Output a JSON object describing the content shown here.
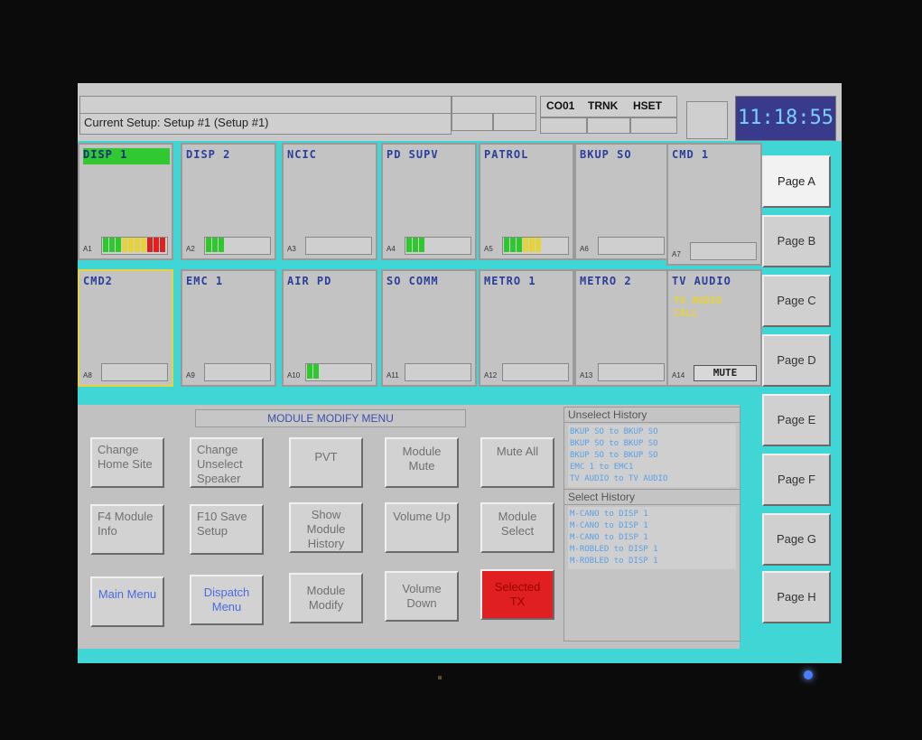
{
  "header": {
    "setup_text": "Current Setup: Setup #1 (Setup #1)",
    "co_label": "CO01",
    "trnk_label": "TRNK",
    "hset_label": "HSET",
    "clock": "11:18:55"
  },
  "modules_row1": [
    {
      "title": "DISP 1",
      "id": "A1"
    },
    {
      "title": "DISP 2",
      "id": "A2"
    },
    {
      "title": "NCIC",
      "id": "A3"
    },
    {
      "title": "PD SUPV",
      "id": "A4"
    },
    {
      "title": "PATROL",
      "id": "A5"
    },
    {
      "title": "BKUP SO",
      "id": "A6"
    },
    {
      "title": "CMD 1",
      "id": "A7"
    }
  ],
  "modules_row2": [
    {
      "title": "CMD2",
      "id": "A8"
    },
    {
      "title": "EMC 1",
      "id": "A9"
    },
    {
      "title": "AIR PD",
      "id": "A10"
    },
    {
      "title": "SO COMM",
      "id": "A11"
    },
    {
      "title": "METRO 1",
      "id": "A12"
    },
    {
      "title": "METRO 2",
      "id": "A13"
    },
    {
      "title": "TV AUDIO",
      "id": "A14",
      "sub1": "TV AUDIO",
      "sub2": "CALL",
      "mute": "MUTE"
    }
  ],
  "menu": {
    "title": "MODULE MODIFY MENU",
    "buttons": [
      "Change Home Site",
      "Change Unselect Speaker",
      "PVT",
      "Module Mute",
      "Mute All",
      "F4 Module Info",
      "F10 Save Setup",
      "Show Module History",
      "Volume Up",
      "Module Select",
      "Main Menu",
      "Dispatch Menu",
      "Module Modify",
      "Volume Down",
      "Selected TX"
    ]
  },
  "unselect_history": {
    "title": "Unselect History",
    "rows": [
      "BKUP SO   to BKUP SO",
      "BKUP SO   to BKUP SO",
      "BKUP SO   to BKUP SO",
      "EMC 1     to EMC1",
      "TV AUDIO to TV AUDIO"
    ]
  },
  "select_history": {
    "title": "Select History",
    "rows": [
      "M-CANO    to DISP 1",
      "M-CANO    to DISP 1",
      "M-CANO    to DISP 1",
      "M-ROBLED  to DISP 1",
      "M-ROBLED  to DISP 1"
    ]
  },
  "pages": [
    "Page A",
    "Page B",
    "Page C",
    "Page D",
    "Page E",
    "Page F",
    "Page G",
    "Page H"
  ],
  "colors": {
    "selected": "#32c832",
    "tx_button": "#e02020",
    "background": "#40d6d6"
  }
}
